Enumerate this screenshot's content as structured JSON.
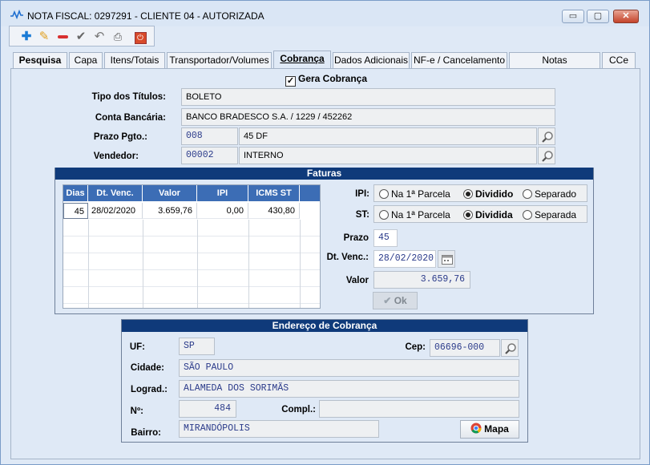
{
  "window": {
    "title": "NOTA FISCAL: 0297291 - CLIENTE 04 - AUTORIZADA",
    "minimize": "▭",
    "maximize": "▢",
    "close": "✕"
  },
  "toolbar": {
    "icons": [
      "add-icon",
      "edit-icon",
      "remove-icon",
      "confirm-icon",
      "undo-icon",
      "print-icon",
      "power-icon"
    ]
  },
  "tabs": [
    {
      "label": "Pesquisa"
    },
    {
      "label": "Capa"
    },
    {
      "label": "Itens/Totais"
    },
    {
      "label": "Transportador/Volumes"
    },
    {
      "label": "Cobrança"
    },
    {
      "label": "Dados Adicionais"
    },
    {
      "label": "NF-e / Cancelamento"
    },
    {
      "label": "Notas Referenciadas"
    },
    {
      "label": "CCe"
    }
  ],
  "cobranca": {
    "gera_cobranca_label": "Gera Cobrança",
    "gera_cobranca_checked": "✓",
    "tipo_titulos_label": "Tipo dos Títulos:",
    "tipo_titulos_value": "BOLETO",
    "conta_bancaria_label": "Conta Bancária:",
    "conta_bancaria_value": "BANCO BRADESCO S.A. / 1229 / 452262",
    "prazo_pgto_label": "Prazo Pgto.:",
    "prazo_pgto_code": "008",
    "prazo_pgto_desc": "45 DF",
    "vendedor_label": "Vendedor:",
    "vendedor_code": "00002",
    "vendedor_desc": "INTERNO"
  },
  "faturas": {
    "title": "Faturas",
    "columns": [
      "Dias",
      "Dt. Venc.",
      "Valor",
      "IPI",
      "ICMS ST"
    ],
    "rows": [
      {
        "dias": "45",
        "dt_venc": "28/02/2020",
        "valor": "3.659,76",
        "ipi": "0,00",
        "icms_st": "430,80"
      }
    ],
    "ipi_label": "IPI:",
    "ipi_options": [
      "Na 1ª Parcela",
      "Dividido",
      "Separado"
    ],
    "ipi_selected": "Dividido",
    "st_label": "ST:",
    "st_options": [
      "Na 1ª Parcela",
      "Dividida",
      "Separada"
    ],
    "st_selected": "Dividida",
    "prazo_label": "Prazo",
    "prazo_value": "45",
    "dt_venc_label": "Dt. Venc.:",
    "dt_venc_value": "28/02/2020",
    "valor_label": "Valor",
    "valor_value": "3.659,76",
    "ok_label": "Ok"
  },
  "endereco": {
    "title": "Endereço de Cobrança",
    "uf_label": "UF:",
    "uf_value": "SP",
    "cep_label": "Cep:",
    "cep_value": "06696-000",
    "cidade_label": "Cidade:",
    "cidade_value": "SÃO PAULO",
    "lograd_label": "Lograd.:",
    "lograd_value": "ALAMEDA DOS SORIMÃS",
    "numero_label": "Nº:",
    "numero_value": "484",
    "compl_label": "Compl.:",
    "compl_value": "",
    "bairro_label": "Bairro:",
    "bairro_value": "MIRANDÓPOLIS",
    "mapa_label": "Mapa"
  }
}
